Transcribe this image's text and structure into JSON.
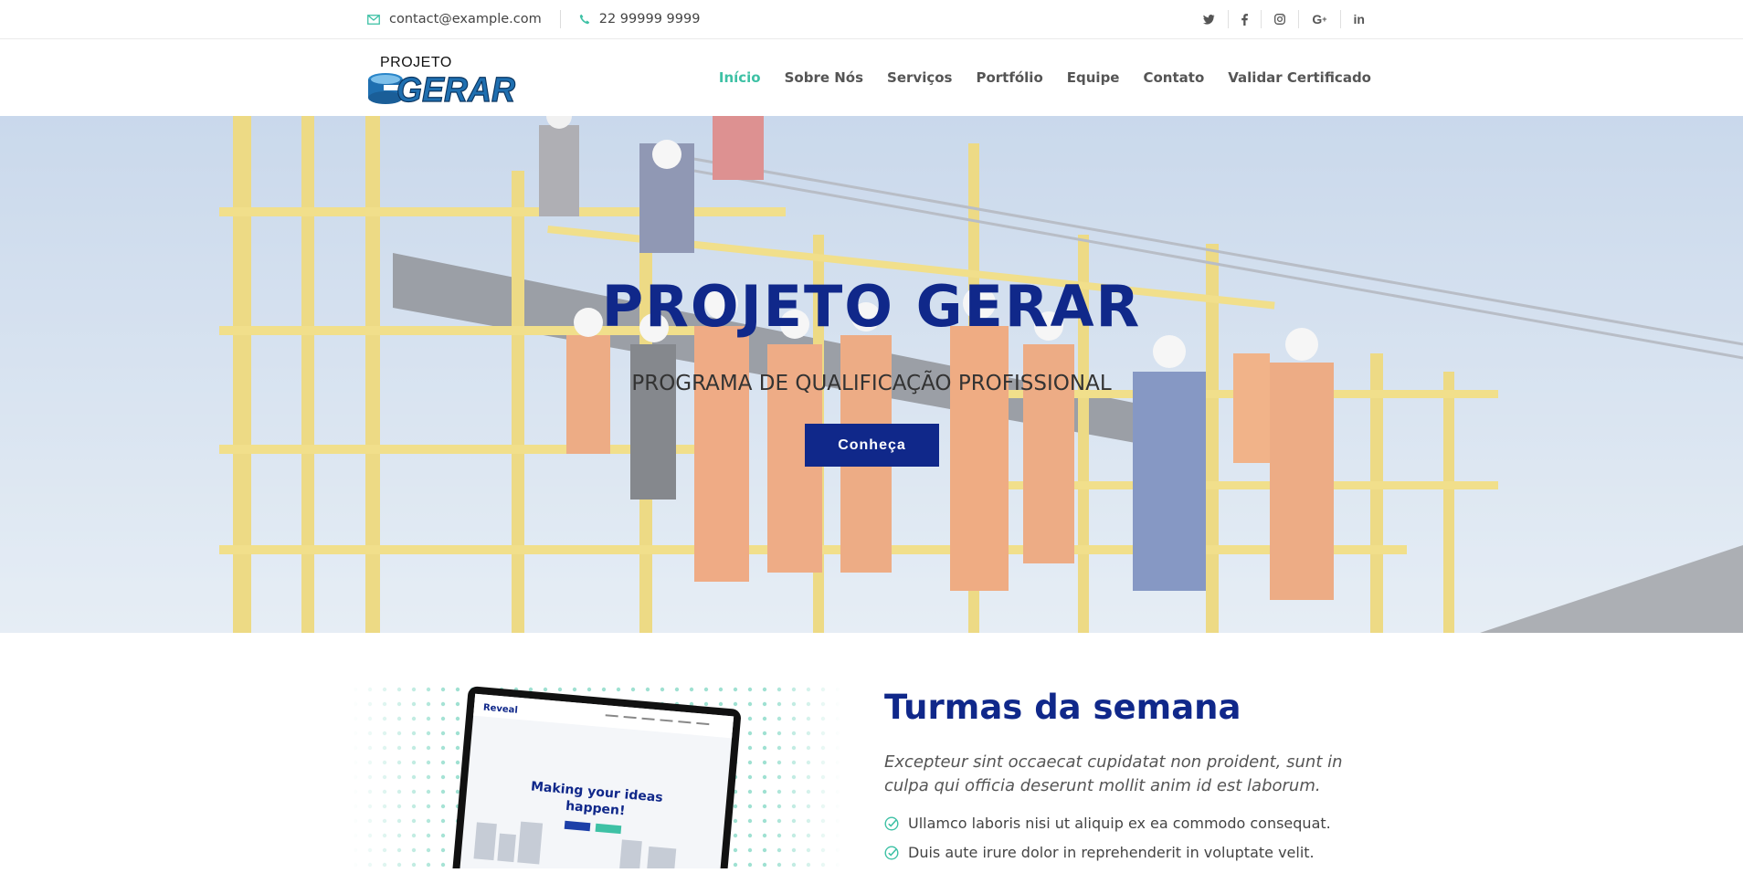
{
  "topbar": {
    "email": "contact@example.com",
    "phone": "22 99999 9999",
    "social": [
      {
        "icon": "twitter-icon",
        "glyph": "𝕏"
      },
      {
        "icon": "facebook-icon",
        "glyph": "f"
      },
      {
        "icon": "instagram-icon",
        "glyph": "◻"
      },
      {
        "icon": "google-plus-icon",
        "glyph": "G+"
      },
      {
        "icon": "linkedin-icon",
        "glyph": "in"
      }
    ]
  },
  "logo": {
    "small_text": "PROJETO",
    "main_text": "GERAR"
  },
  "nav": {
    "items": [
      "Início",
      "Sobre Nós",
      "Serviços",
      "Portfólio",
      "Equipe",
      "Contato",
      "Validar Certificado"
    ]
  },
  "hero": {
    "title": "PROJETO GERAR",
    "subtitle": "PROGRAMA DE QUALIFICAÇÃO PROFISSIONAL",
    "cta": "Conheça"
  },
  "about": {
    "title": "Turmas da semana",
    "lead": "Excepteur sint occaecat cupidatat non proident, sunt in culpa qui officia deserunt mollit anim id est laborum.",
    "items": [
      "Ullamco laboris nisi ut aliquip ex ea commodo consequat.",
      "Duis aute irure dolor in reprehenderit in voluptate velit."
    ],
    "mockup": {
      "brand": "Reveal",
      "headline_1": "Making your ideas",
      "headline_2": "happen!"
    }
  },
  "colors": {
    "brand_blue": "#10288a",
    "accent_green": "#3ec1a5"
  }
}
